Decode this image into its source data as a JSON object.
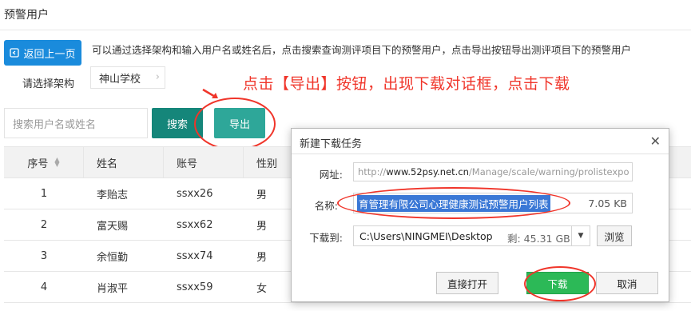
{
  "page": {
    "title": "预警用户",
    "back_label": "返回上一页",
    "description": "可以通过选择架构和输入用户名或姓名后，点击搜索查询测评项目下的预警用户，点击导出按钮导出测评项目下的预警用户",
    "arch_label": "请选择架构",
    "arch_value": "神山学校",
    "search_placeholder": "搜索用户名或姓名",
    "search_label": "搜索",
    "export_label": "导出",
    "annotation": "点击【导出】按钮，出现下载对话框，点击下载"
  },
  "table": {
    "headers": [
      "序号",
      "姓名",
      "账号",
      "性别"
    ],
    "rows": [
      {
        "seq": "1",
        "name": "李贻志",
        "account": "ssxx26",
        "sex": "男"
      },
      {
        "seq": "2",
        "name": "富天赐",
        "account": "ssxx62",
        "sex": "男"
      },
      {
        "seq": "3",
        "name": "余恒勤",
        "account": "ssxx74",
        "sex": "男"
      },
      {
        "seq": "4",
        "name": "肖淑平",
        "account": "ssxx59",
        "sex": "女"
      }
    ]
  },
  "dialog": {
    "title": "新建下载任务",
    "url_label": "网址:",
    "url_prefix": "http://",
    "url_host": "www.52psy.net.cn",
    "url_path": "/Manage/scale/warning/prolistexpo",
    "name_label": "名称:",
    "name_value": "育管理有限公司心理健康测试预警用户列表",
    "name_size": "7.05 KB",
    "path_label": "下载到:",
    "path_value": "C:\\Users\\NINGMEI\\Desktop",
    "free_space": "剩: 45.31 GB",
    "browse_label": "浏览",
    "open_label": "直接打开",
    "download_label": "下载",
    "cancel_label": "取消"
  },
  "colors": {
    "back_button": "#1a8bdc",
    "search_button": "#15867a",
    "export_button": "#2ea799",
    "download_button": "#2cb957",
    "annotation": "#f0352a"
  }
}
